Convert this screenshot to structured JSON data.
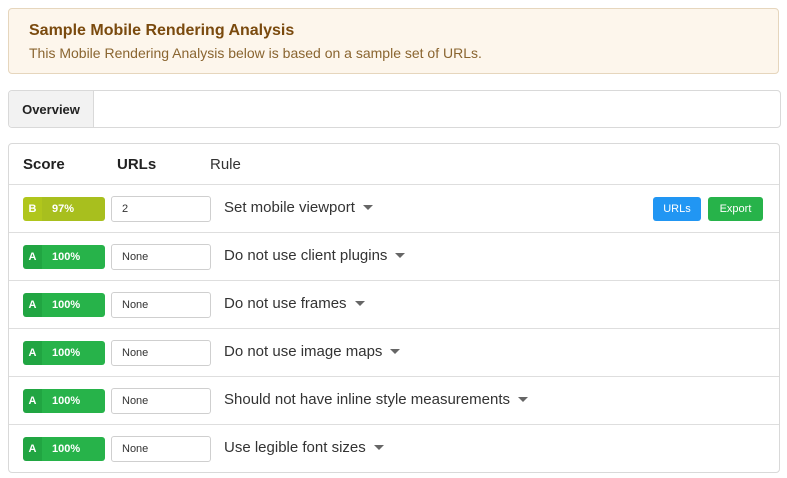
{
  "notice": {
    "title": "Sample Mobile Rendering Analysis",
    "text": "This Mobile Rendering Analysis below is based on a sample set of URLs.",
    "bg_color": "#fdf6ec",
    "title_color": "#7a4a0e"
  },
  "tabs": [
    {
      "label": "Overview",
      "active": true
    }
  ],
  "table": {
    "headers": {
      "score": "Score",
      "urls": "URLs",
      "rule": "Rule"
    },
    "rows": [
      {
        "grade": "B",
        "percent": "97%",
        "percent_value": 97,
        "letter_color": "#b0c61c",
        "bar_color": "#a8bf1e",
        "urls": "2",
        "rule": "Set mobile viewport",
        "actions": {
          "urls_label": "URLs",
          "export_label": "Export"
        }
      },
      {
        "grade": "A",
        "percent": "100%",
        "percent_value": 100,
        "letter_color": "#21a542",
        "bar_color": "#27b34a",
        "urls": "None",
        "rule": "Do not use client plugins"
      },
      {
        "grade": "A",
        "percent": "100%",
        "percent_value": 100,
        "letter_color": "#21a542",
        "bar_color": "#27b34a",
        "urls": "None",
        "rule": "Do not use frames"
      },
      {
        "grade": "A",
        "percent": "100%",
        "percent_value": 100,
        "letter_color": "#21a542",
        "bar_color": "#27b34a",
        "urls": "None",
        "rule": "Do not use image maps"
      },
      {
        "grade": "A",
        "percent": "100%",
        "percent_value": 100,
        "letter_color": "#21a542",
        "bar_color": "#27b34a",
        "urls": "None",
        "rule": "Should not have inline style measurements"
      },
      {
        "grade": "A",
        "percent": "100%",
        "percent_value": 100,
        "letter_color": "#21a542",
        "bar_color": "#27b34a",
        "urls": "None",
        "rule": "Use legible font sizes"
      }
    ]
  },
  "colors": {
    "primary_button": "#2196f3",
    "success_button": "#27b34a"
  },
  "icons": {
    "rule_dropdown": "caret-down-icon"
  }
}
